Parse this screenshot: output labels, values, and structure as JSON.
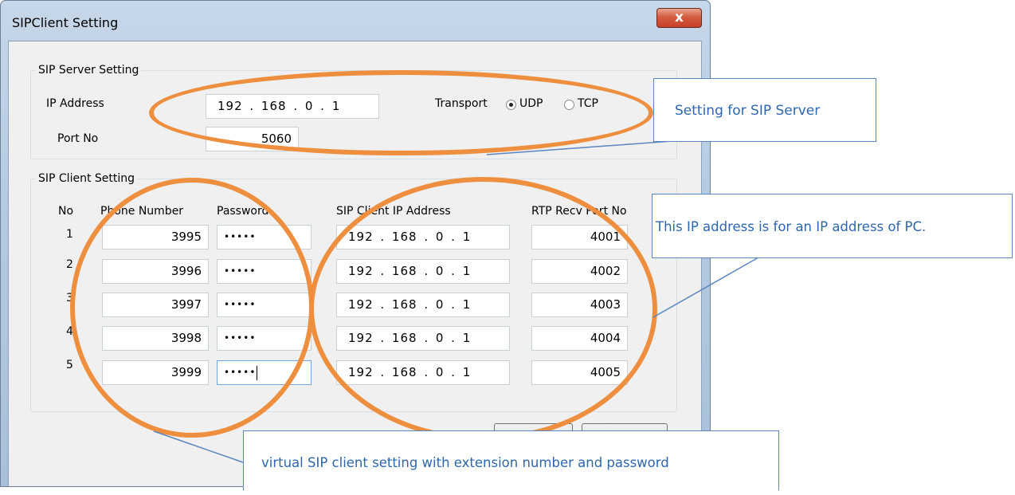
{
  "window": {
    "title": "SIPClient Setting",
    "close_glyph": "x"
  },
  "server_group": {
    "legend": "SIP Server Setting",
    "ip_label": "IP Address",
    "ip_value": "192 . 168 . 0 . 1",
    "port_label": "Port No",
    "port_value": "5060",
    "transport_label": "Transport",
    "transport_options": [
      "UDP",
      "TCP"
    ],
    "transport_selected": "UDP"
  },
  "client_group": {
    "legend": "SIP Client Setting",
    "headers": [
      "No",
      "Phone Number",
      "Password",
      "SIP Client IP Address",
      "RTP Recv Port No"
    ],
    "rows": [
      {
        "no": "1",
        "phone": "3995",
        "password": "•••••",
        "ip": "192 . 168 . 0 . 1",
        "rtp_port": "4001"
      },
      {
        "no": "2",
        "phone": "3996",
        "password": "•••••",
        "ip": "192 . 168 . 0 . 1",
        "rtp_port": "4002"
      },
      {
        "no": "3",
        "phone": "3997",
        "password": "•••••",
        "ip": "192 . 168 . 0 . 1",
        "rtp_port": "4003"
      },
      {
        "no": "4",
        "phone": "3998",
        "password": "•••••",
        "ip": "192 . 168 . 0 . 1",
        "rtp_port": "4004"
      },
      {
        "no": "5",
        "phone": "3999",
        "password": "•••••",
        "ip": "192 . 168 . 0 . 1",
        "rtp_port": "4005"
      }
    ]
  },
  "annotations": {
    "server_note": "Setting for SIP Server",
    "ip_note": "This IP address is for an IP address of PC.",
    "client_note": "virtual SIP client setting with extension number and password"
  },
  "colors": {
    "highlight_ellipse": "#ed8f3f",
    "callout_border": "#5b86c0",
    "callout_text": "#2e67b0"
  }
}
